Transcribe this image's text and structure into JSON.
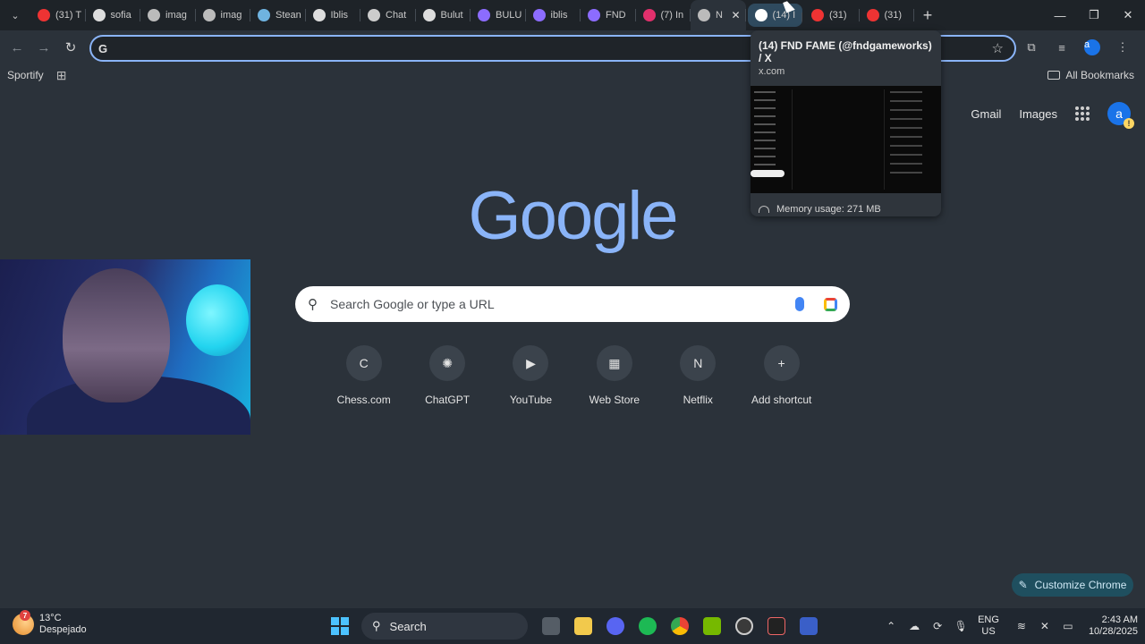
{
  "tabs": [
    {
      "label": "(31) T",
      "icon": "youtube-icon",
      "color": "#e33"
    },
    {
      "label": "sofia",
      "icon": "google-icon",
      "color": "#ddd"
    },
    {
      "label": "imag",
      "icon": "globe-icon",
      "color": "#bbb"
    },
    {
      "label": "imag",
      "icon": "globe-icon",
      "color": "#bbb"
    },
    {
      "label": "Stean",
      "icon": "steam-icon",
      "color": "#6fb3e0"
    },
    {
      "label": "Iblis",
      "icon": "google-icon",
      "color": "#ddd"
    },
    {
      "label": "Chat",
      "icon": "openai-icon",
      "color": "#ccc"
    },
    {
      "label": "Bulut",
      "icon": "google-icon",
      "color": "#ddd"
    },
    {
      "label": "BULU",
      "icon": "suno-icon",
      "color": "#8c6cff"
    },
    {
      "label": "iblis",
      "icon": "suno-icon",
      "color": "#8c6cff"
    },
    {
      "label": "FND",
      "icon": "suno-icon",
      "color": "#8c6cff"
    },
    {
      "label": "(7) In",
      "icon": "instagram-icon",
      "color": "#e1306c"
    },
    {
      "label": "N",
      "icon": "chrome-icon",
      "color": "#bbb",
      "active": true
    },
    {
      "label": "(14) I",
      "icon": "x-icon",
      "color": "#fff",
      "hovered": true
    },
    {
      "label": "(31)",
      "icon": "youtube-icon",
      "color": "#e33"
    },
    {
      "label": "(31)",
      "icon": "youtube-icon",
      "color": "#e33"
    }
  ],
  "toolbar": {
    "omnibox_value": "",
    "bookmark_star": "☆"
  },
  "bookmarks": {
    "items": [
      "Sportify"
    ],
    "all_label": "All Bookmarks"
  },
  "ntp": {
    "gmail": "Gmail",
    "images": "Images",
    "avatar_letter": "a",
    "logo": "Google",
    "search_placeholder": "Search Google or type a URL",
    "shortcuts": [
      {
        "label": "Chess.com",
        "glyph": "C"
      },
      {
        "label": "ChatGPT",
        "glyph": "✺"
      },
      {
        "label": "YouTube",
        "glyph": "▶"
      },
      {
        "label": "Web Store",
        "glyph": "▦"
      },
      {
        "label": "Netflix",
        "glyph": "N"
      },
      {
        "label": "Add shortcut",
        "glyph": "+"
      }
    ],
    "customize_label": "Customize Chrome"
  },
  "hovercard": {
    "title": "(14) FND FAME (@fndgameworks) / X",
    "url": "x.com",
    "memory": "Memory usage: 271 MB"
  },
  "taskbar": {
    "temp": "13°C",
    "condition": "Despejado",
    "weather_badge": "7",
    "search_label": "Search",
    "lang_line1": "ENG",
    "lang_line2": "US",
    "time": "2:43 AM",
    "date": "10/28/2025"
  },
  "colors": {
    "accent": "#8ab4f8",
    "page_bg": "#2b323a"
  }
}
